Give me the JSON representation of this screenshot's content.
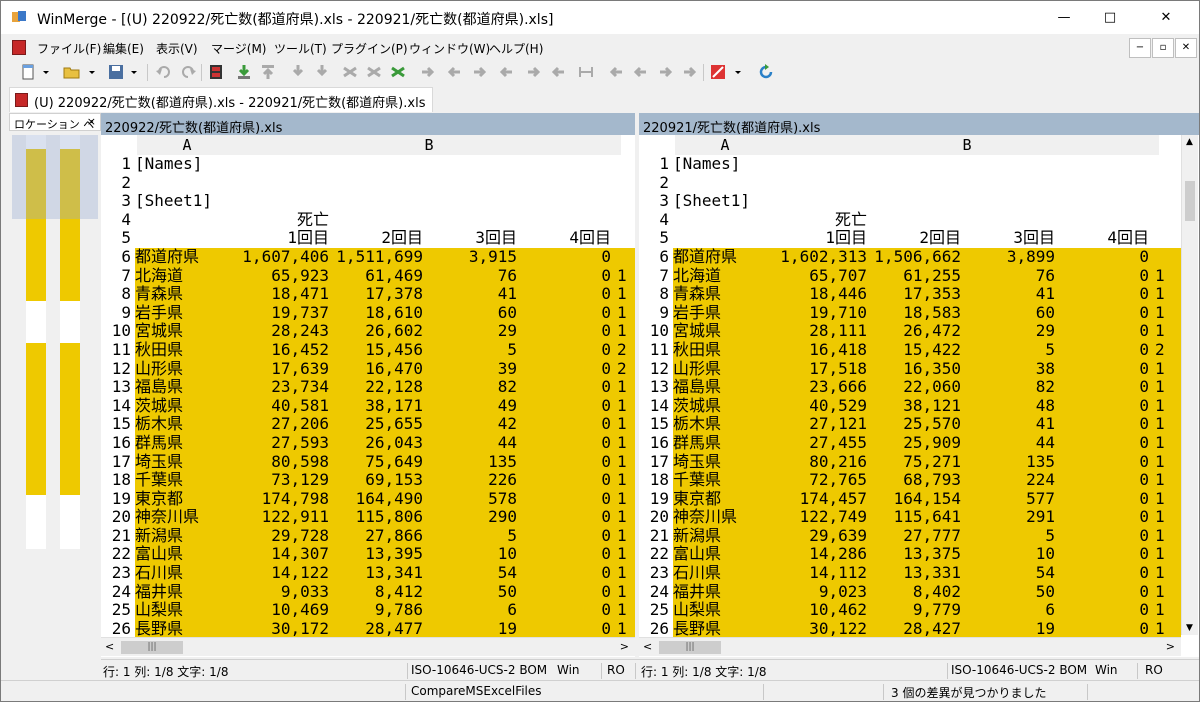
{
  "window": {
    "title": "WinMerge - [(U) 220922/死亡数(都道府県).xls - 220921/死亡数(都道府県).xls]",
    "minimize": "—",
    "maximize": "□",
    "close": "✕"
  },
  "menu": [
    "ファイル(F)",
    "編集(E)",
    "表示(V)",
    "マージ(M)",
    "ツール(T)",
    "プラグイン(P)",
    "ウィンドウ(W)",
    "ヘルプ(H)"
  ],
  "mdi": {
    "minimize": "−",
    "restore": "▫",
    "close": "✕"
  },
  "tab": {
    "label": "(U) 220922/死亡数(都道府県).xls - 220921/死亡数(都道府県).xls"
  },
  "location_pane": {
    "title": "ロケーション ペ",
    "close": "×"
  },
  "left": {
    "header": "220922/死亡数(都道府県).xls",
    "col_a": "A",
    "col_b": "B",
    "rows": [
      [
        "1",
        "[Names]",
        "",
        "",
        "",
        "",
        ""
      ],
      [
        "2",
        "",
        "",
        "",
        "",
        "",
        ""
      ],
      [
        "3",
        "[Sheet1]",
        "",
        "",
        "",
        "",
        ""
      ],
      [
        "4",
        "",
        "死亡",
        "",
        "",
        "",
        ""
      ],
      [
        "5",
        "",
        "1回目",
        "2回目",
        "3回目",
        "4回目",
        ""
      ],
      [
        "6",
        "都道府県",
        "1,607,406",
        "1,511,699",
        "3,915",
        "0",
        ""
      ],
      [
        "7",
        "北海道",
        "65,923",
        "61,469",
        "76",
        "0",
        "1"
      ],
      [
        "8",
        "青森県",
        "18,471",
        "17,378",
        "41",
        "0",
        "1"
      ],
      [
        "9",
        "岩手県",
        "19,737",
        "18,610",
        "60",
        "0",
        "1"
      ],
      [
        "10",
        "宮城県",
        "28,243",
        "26,602",
        "29",
        "0",
        "1"
      ],
      [
        "11",
        "秋田県",
        "16,452",
        "15,456",
        "5",
        "0",
        "2"
      ],
      [
        "12",
        "山形県",
        "17,639",
        "16,470",
        "39",
        "0",
        "2"
      ],
      [
        "13",
        "福島県",
        "23,734",
        "22,128",
        "82",
        "0",
        "1"
      ],
      [
        "14",
        "茨城県",
        "40,581",
        "38,171",
        "49",
        "0",
        "1"
      ],
      [
        "15",
        "栃木県",
        "27,206",
        "25,655",
        "42",
        "0",
        "1"
      ],
      [
        "16",
        "群馬県",
        "27,593",
        "26,043",
        "44",
        "0",
        "1"
      ],
      [
        "17",
        "埼玉県",
        "80,598",
        "75,649",
        "135",
        "0",
        "1"
      ],
      [
        "18",
        "千葉県",
        "73,129",
        "69,153",
        "226",
        "0",
        "1"
      ],
      [
        "19",
        "東京都",
        "174,798",
        "164,490",
        "578",
        "0",
        "1"
      ],
      [
        "20",
        "神奈川県",
        "122,911",
        "115,806",
        "290",
        "0",
        "1"
      ],
      [
        "21",
        "新潟県",
        "29,728",
        "27,866",
        "5",
        "0",
        "1"
      ],
      [
        "22",
        "富山県",
        "14,307",
        "13,395",
        "10",
        "0",
        "1"
      ],
      [
        "23",
        "石川県",
        "14,122",
        "13,341",
        "54",
        "0",
        "1"
      ],
      [
        "24",
        "福井県",
        "9,033",
        "8,412",
        "50",
        "0",
        "1"
      ],
      [
        "25",
        "山梨県",
        "10,469",
        "9,786",
        "6",
        "0",
        "1"
      ],
      [
        "26",
        "長野県",
        "30,172",
        "28,477",
        "19",
        "0",
        "1"
      ]
    ]
  },
  "right": {
    "header": "220921/死亡数(都道府県).xls",
    "col_a": "A",
    "col_b": "B",
    "rows": [
      [
        "1",
        "[Names]",
        "",
        "",
        "",
        "",
        ""
      ],
      [
        "2",
        "",
        "",
        "",
        "",
        "",
        ""
      ],
      [
        "3",
        "[Sheet1]",
        "",
        "",
        "",
        "",
        ""
      ],
      [
        "4",
        "",
        "死亡",
        "",
        "",
        "",
        ""
      ],
      [
        "5",
        "",
        "1回目",
        "2回目",
        "3回目",
        "4回目",
        ""
      ],
      [
        "6",
        "都道府県",
        "1,602,313",
        "1,506,662",
        "3,899",
        "0",
        ""
      ],
      [
        "7",
        "北海道",
        "65,707",
        "61,255",
        "76",
        "0",
        "1"
      ],
      [
        "8",
        "青森県",
        "18,446",
        "17,353",
        "41",
        "0",
        "1"
      ],
      [
        "9",
        "岩手県",
        "19,710",
        "18,583",
        "60",
        "0",
        "1"
      ],
      [
        "10",
        "宮城県",
        "28,111",
        "26,472",
        "29",
        "0",
        "1"
      ],
      [
        "11",
        "秋田県",
        "16,418",
        "15,422",
        "5",
        "0",
        "2"
      ],
      [
        "12",
        "山形県",
        "17,518",
        "16,350",
        "38",
        "0",
        "1"
      ],
      [
        "13",
        "福島県",
        "23,666",
        "22,060",
        "82",
        "0",
        "1"
      ],
      [
        "14",
        "茨城県",
        "40,529",
        "38,121",
        "48",
        "0",
        "1"
      ],
      [
        "15",
        "栃木県",
        "27,121",
        "25,570",
        "41",
        "0",
        "1"
      ],
      [
        "16",
        "群馬県",
        "27,455",
        "25,909",
        "44",
        "0",
        "1"
      ],
      [
        "17",
        "埼玉県",
        "80,216",
        "75,271",
        "135",
        "0",
        "1"
      ],
      [
        "18",
        "千葉県",
        "72,765",
        "68,793",
        "224",
        "0",
        "1"
      ],
      [
        "19",
        "東京都",
        "174,457",
        "164,154",
        "577",
        "0",
        "1"
      ],
      [
        "20",
        "神奈川県",
        "122,749",
        "115,641",
        "291",
        "0",
        "1"
      ],
      [
        "21",
        "新潟県",
        "29,639",
        "27,777",
        "5",
        "0",
        "1"
      ],
      [
        "22",
        "富山県",
        "14,286",
        "13,375",
        "10",
        "0",
        "1"
      ],
      [
        "23",
        "石川県",
        "14,112",
        "13,331",
        "54",
        "0",
        "1"
      ],
      [
        "24",
        "福井県",
        "9,023",
        "8,402",
        "50",
        "0",
        "1"
      ],
      [
        "25",
        "山梨県",
        "10,462",
        "9,779",
        "6",
        "0",
        "1"
      ],
      [
        "26",
        "長野県",
        "30,122",
        "28,427",
        "19",
        "0",
        "1"
      ]
    ]
  },
  "status_left": {
    "pos": "行: 1  列: 1/8  文字: 1/8",
    "enc": "ISO-10646-UCS-2 BOM",
    "eol": "Win",
    "ro": "RO"
  },
  "status_right": {
    "pos": "行: 1  列: 1/8  文字: 1/8",
    "enc": "ISO-10646-UCS-2 BOM",
    "eol": "Win",
    "ro": "RO"
  },
  "statusbar": {
    "plugin": "CompareMSExcelFiles",
    "diffs": "3 個の差異が見つかりました"
  },
  "colors": {
    "diff": "#eec900",
    "diff_word": "#f5e6b5",
    "pane_header": "#a4b8cc"
  }
}
